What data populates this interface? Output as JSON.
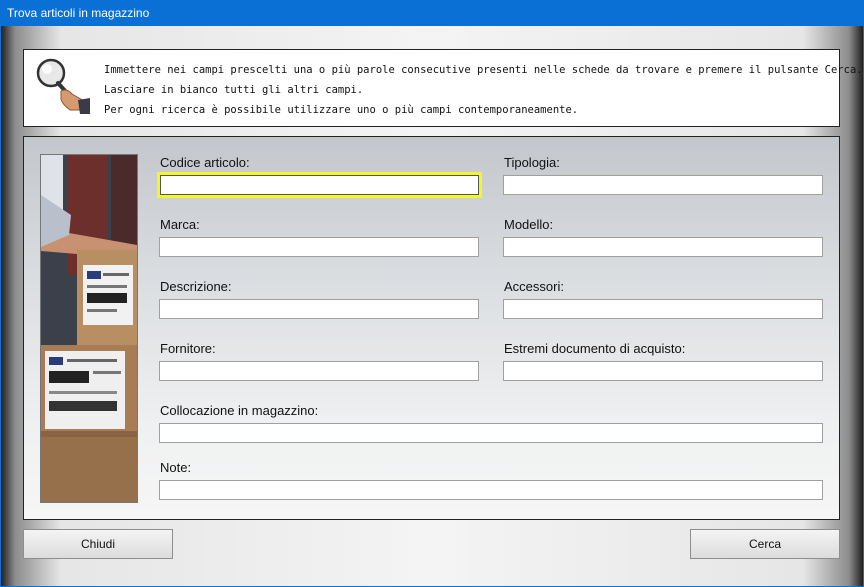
{
  "window": {
    "title": "Trova articoli in magazzino"
  },
  "info": {
    "lines": [
      "Immettere nei campi prescelti una o più parole consecutive presenti nelle schede da trovare e premere il pulsante Cerca.",
      "Lasciare in bianco tutti gli altri campi.",
      "Per ogni ricerca è possibile utilizzare uno o più campi contemporaneamente."
    ]
  },
  "form": {
    "codice_articolo": {
      "label": "Codice articolo:",
      "value": ""
    },
    "tipologia": {
      "label": "Tipologia:",
      "value": ""
    },
    "marca": {
      "label": "Marca:",
      "value": ""
    },
    "modello": {
      "label": "Modello:",
      "value": ""
    },
    "descrizione": {
      "label": "Descrizione:",
      "value": ""
    },
    "accessori": {
      "label": "Accessori:",
      "value": ""
    },
    "fornitore": {
      "label": "Fornitore:",
      "value": ""
    },
    "estremi_documento": {
      "label": "Estremi documento di acquisto:",
      "value": ""
    },
    "collocazione": {
      "label": "Collocazione in magazzino:",
      "value": ""
    },
    "note": {
      "label": "Note:",
      "value": ""
    }
  },
  "buttons": {
    "close": "Chiudi",
    "search": "Cerca"
  },
  "icons": {
    "info": "magnifier-hand-icon"
  },
  "colors": {
    "titlebar": "#0a70d6",
    "focus_ring": "#f5f528"
  }
}
